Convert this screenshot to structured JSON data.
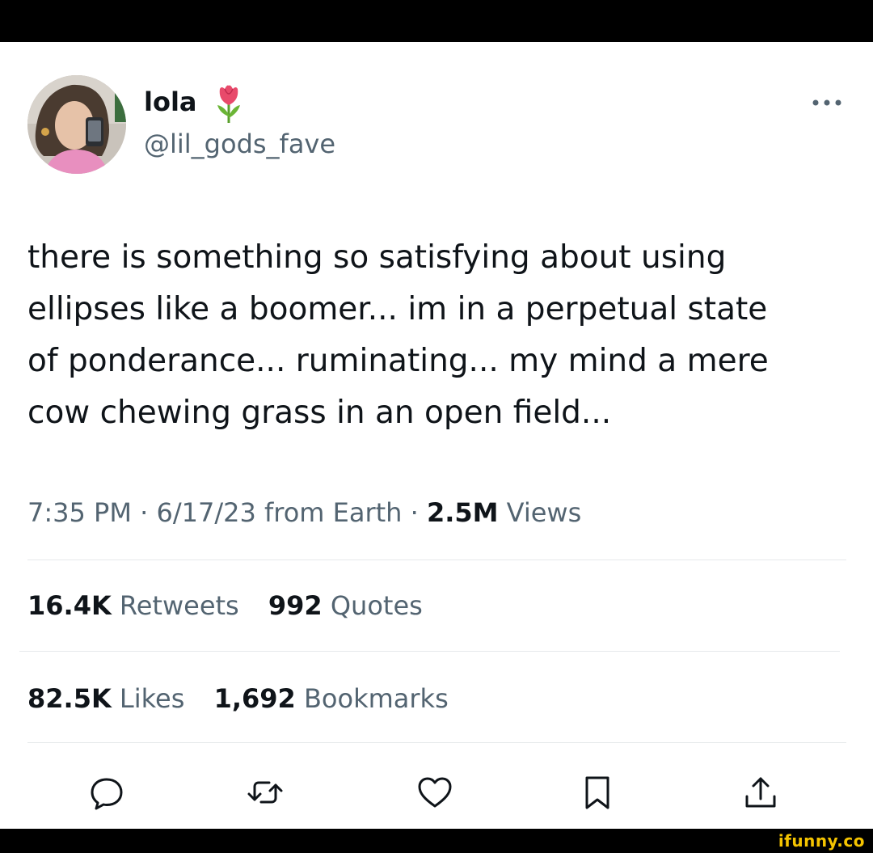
{
  "tweet": {
    "display_name": "lola",
    "handle": "@lil_gods_fave",
    "text": "there is something so satisfying about using\nellipses like a boomer... im in a perpetual state\nof ponderance... ruminating... my mind a mere\ncow chewing grass in an open field...",
    "time": "7:35 PM",
    "date": "6/17/23",
    "source": "from Earth",
    "views_count": "2.5M",
    "views_label": "Views",
    "separator": "·"
  },
  "stats": {
    "retweets_count": "16.4K",
    "retweets_label": "Retweets",
    "quotes_count": "992",
    "quotes_label": "Quotes",
    "likes_count": "82.5K",
    "likes_label": "Likes",
    "bookmarks_count": "1,692",
    "bookmarks_label": "Bookmarks"
  },
  "watermark": "ifunny.co",
  "icons": [
    "tulip-icon",
    "more-icon",
    "reply-icon",
    "retweet-icon",
    "like-icon",
    "bookmark-icon",
    "share-icon"
  ],
  "colors": {
    "text_primary": "#0f1419",
    "text_secondary": "#536471",
    "divider": "#e6e9eb",
    "watermark": "#f5c400"
  }
}
